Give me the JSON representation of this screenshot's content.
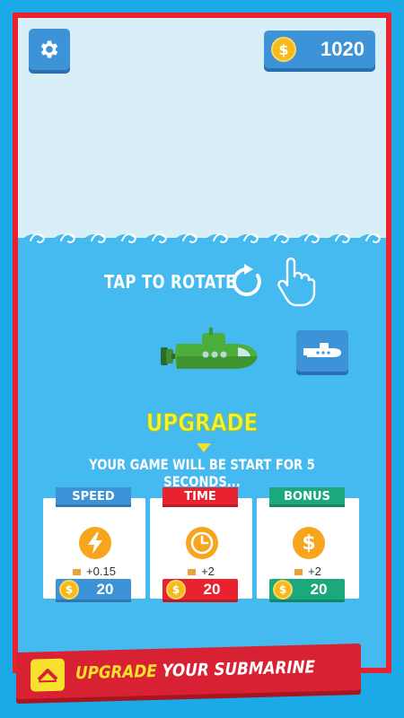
{
  "hud": {
    "coins": "1020",
    "coin_symbol": "$"
  },
  "play": {
    "tap_to_rotate": "TAP TO ROTATE"
  },
  "upgrade": {
    "title": "UPGRADE",
    "info": "YOUR GAME WILL BE START FOR 5 SECONDS...",
    "cards": [
      {
        "label": "SPEED",
        "bonus": "+0.15",
        "price": "20",
        "color": "#3d93d8",
        "icon": "lightning-icon"
      },
      {
        "label": "TIME",
        "bonus": "+2",
        "price": "20",
        "color": "#e8222f",
        "icon": "clock-icon"
      },
      {
        "label": "BONUS",
        "bonus": "+2",
        "price": "20",
        "color": "#1aa87c",
        "icon": "dollar-coin-icon"
      }
    ]
  },
  "banner": {
    "highlight": "UPGRADE",
    "rest": "YOUR SUBMARINE"
  },
  "colors": {
    "frame": "#e8222f",
    "sea": "#44baf0",
    "sky": "#d9eff7",
    "button": "#3d93d8",
    "accent_yellow": "#f3f33a"
  }
}
